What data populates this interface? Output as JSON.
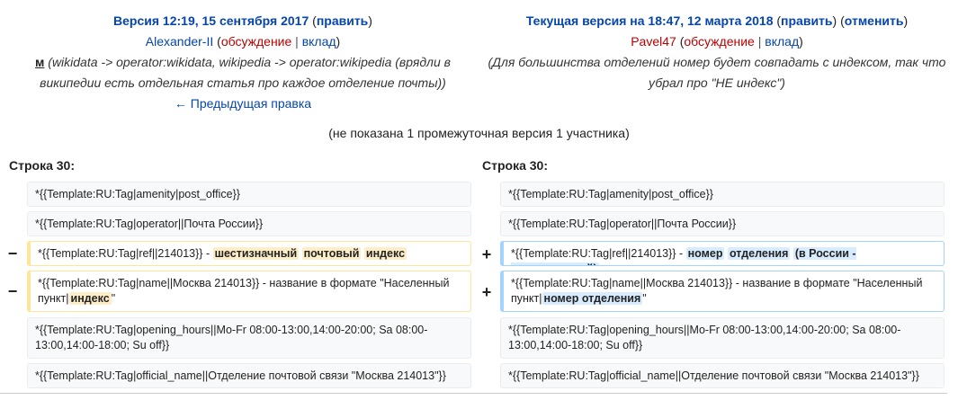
{
  "left_header": {
    "title": "Версия 12:19, 15 сентября 2017",
    "edit_paren_open": " (",
    "edit_link": "править",
    "edit_paren_close": ")",
    "user": "Alexander-II",
    "talk_paren_open": " (",
    "talk_link": "обсуждение",
    "sep": " | ",
    "contribs_link": "вклад",
    "talk_paren_close": ")",
    "minor_mark": "м",
    "summary": "(wikidata -> operator:wikidata, wikipedia -> operator:wikipedia (врядли в википедии есть отдельная статья про каждое отделение почты))",
    "prev_link": "← Предыдущая правка"
  },
  "right_header": {
    "title": "Текущая версия на 18:47, 12 марта 2018",
    "edit_paren_open": " (",
    "edit_link": "править",
    "edit_paren_close": ")",
    "undo_paren_open": " (",
    "undo_link": "отменить",
    "undo_paren_close": ")",
    "user": "Pavel47",
    "talk_paren_open": " (",
    "talk_link": "обсуждение",
    "sep": " | ",
    "contribs_link": "вклад",
    "talk_paren_close": ")",
    "summary": "(Для большинства отделений номер будет совпадать с индексом, так что убрал про \"НЕ индекс\")"
  },
  "notice": "(не показана 1 промежуточная версия 1 участника)",
  "line_label_left": "Строка 30:",
  "line_label_right": "Строка 30:",
  "markers": {
    "minus": "−",
    "plus": "+"
  },
  "context": {
    "amenity": "*{{Template:RU:Tag|amenity|post_office}}",
    "operator": "*{{Template:RU:Tag|operator||Почта России}}",
    "opening": "*{{Template:RU:Tag|opening_hours||Mo-Fr 08:00-13:00,14:00-20:00; Sa 08:00-13:00,14:00-18:00; Su off}}",
    "official": "*{{Template:RU:Tag|official_name||Отделение почтовой связи \"Москва 214013\"}}"
  },
  "deleted": {
    "ref_pre": "*{{Template:RU:Tag|ref||214013}} - ",
    "ref_w1": "шестизначный",
    "ref_w2": "почтовый",
    "ref_w3": "индекс",
    "name_pre": "*{{Template:RU:Tag|name||Москва 214013}} - название в формате \"Населенный пункт|",
    "name_hl": "индекс",
    "name_post": "\""
  },
  "added": {
    "ref_pre": "*{{Template:RU:Tag|ref||214013}} - ",
    "ref_w1": "номер",
    "ref_w2": "отделения",
    "ref_w3": "(в России - шестизначный)",
    "name_pre": "*{{Template:RU:Tag|name||Москва 214013}} - название в формате \"Населенный пункт|",
    "name_hl": "номер отделения",
    "name_post": "\""
  }
}
